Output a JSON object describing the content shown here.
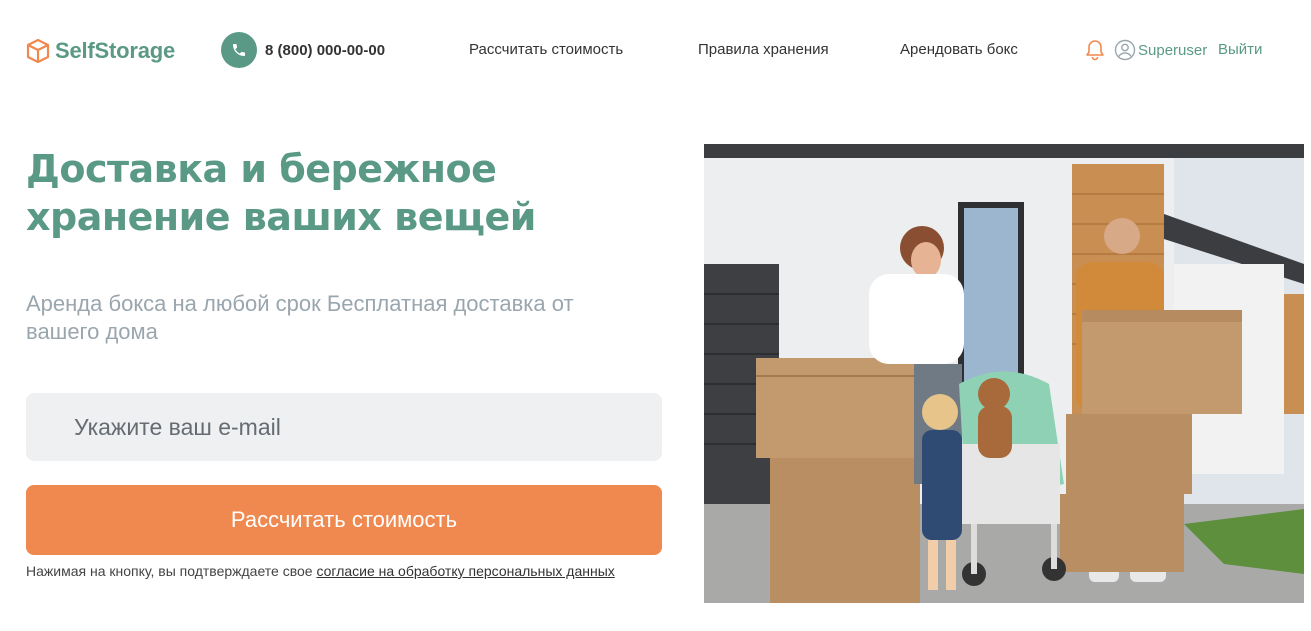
{
  "header": {
    "logo_text": "SelfStorage",
    "phone": "8 (800) 000-00-00",
    "nav": [
      {
        "label": "Рассчитать стоимость"
      },
      {
        "label": "Правила хранения"
      },
      {
        "label": "Арендовать бокс"
      }
    ],
    "username": "Superuser",
    "logout_label": "Выйти",
    "icons": [
      "box-logo-icon",
      "phone-icon",
      "bell-icon",
      "user-icon"
    ]
  },
  "hero": {
    "title": "Доставка и бережное хранение ваших вещей",
    "subtitle": "Аренда бокса на любой срок Бесплатная доставка от вашего дома",
    "email_value": "",
    "email_placeholder": "Укажите ваш e-mail",
    "cta_label": "Рассчитать стоимость",
    "consent_text": "Нажимая на кнопку, вы подтверждаете свое ",
    "consent_link": "согласие на обработку персональных данных"
  },
  "colors": {
    "brand_green": "#5a9985",
    "accent_orange": "#f0894f",
    "input_bg": "#eef0f2",
    "subtitle_gray": "#9aa6ae"
  }
}
